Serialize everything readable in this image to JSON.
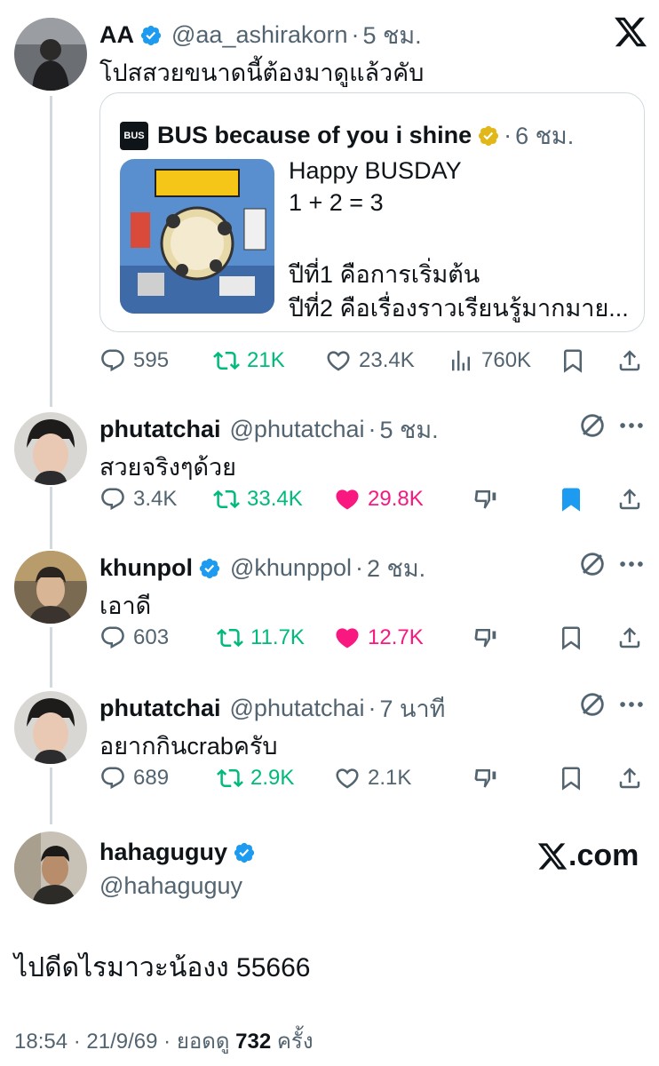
{
  "colors": {
    "accent": "#1d9bf0",
    "muted": "#536471",
    "green": "#00ba7c",
    "pink": "#f91880",
    "gold": "#e2b719"
  },
  "main_tweet": {
    "name": "AA",
    "handle": "@aa_ashirakorn",
    "time": "5 ชม.",
    "text": "โปสสวยขนาดนี้ต้องมาดูแล้วคับ",
    "quote": {
      "name": "BUS because of you i shine",
      "logo_text": "BUS",
      "time": "6 ชม.",
      "lines": [
        "Happy BUSDAY",
        "1 + 2 = 3",
        "",
        "ปีที่1 คือการเริ่มต้น",
        "ปีที่2 คือเรื่องราวเรียนรู้มากมาย..."
      ]
    },
    "stats": {
      "replies": "595",
      "retweets": "21K",
      "likes": "23.4K",
      "views": "760K"
    }
  },
  "replies": [
    {
      "name": "phutatchai",
      "handle": "@phutatchai",
      "time": "5 ชม.",
      "text": "สวยจริงๆด้วย",
      "replies": "3.4K",
      "retweets": "33.4K",
      "likes": "29.8K"
    },
    {
      "name": "khunpol",
      "handle": "@khunppol",
      "time": "2 ชม.",
      "text": "เอาดี",
      "replies": "603",
      "retweets": "11.7K",
      "likes": "12.7K"
    },
    {
      "name": "phutatchai",
      "handle": "@phutatchai",
      "time": "7 นาที",
      "text": "อยากกินcrabครับ",
      "replies": "689",
      "retweets": "2.9K",
      "likes": "2.1K"
    }
  ],
  "final_tweet": {
    "name": "hahaguguy",
    "handle": "@hahaguguy",
    "brand": ".com",
    "text": "ไปดีดไรมาวะน้องง 55666",
    "time": "18:54",
    "date": "21/9/69",
    "views_label": "ยอดดู",
    "views": "732",
    "views_unit": "ครั้ง"
  },
  "sep": "·"
}
